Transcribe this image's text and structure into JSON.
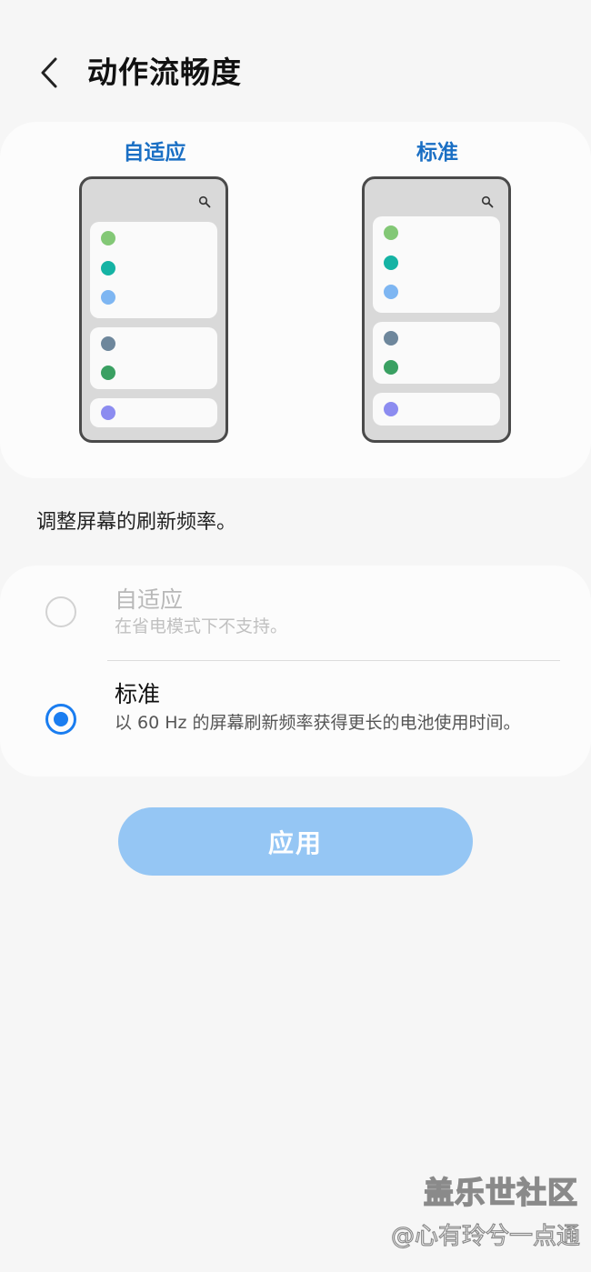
{
  "header": {
    "back_icon": "chevron-left-icon",
    "title": "动作流畅度"
  },
  "preview": {
    "adaptive_label": "自适应",
    "standard_label": "标准",
    "search_icon": "search-icon",
    "dot_colors": [
      "#83c876",
      "#15b3a4",
      "#7eb6f2",
      "#6e879c",
      "#3aa062",
      "#8c8cf0"
    ]
  },
  "description": "调整屏幕的刷新频率。",
  "options": {
    "adaptive": {
      "title": "自适应",
      "subtitle": "在省电模式下不支持。",
      "selected": false,
      "enabled": false
    },
    "standard": {
      "title": "标准",
      "subtitle": "以 60 Hz 的屏幕刷新频率获得更长的电池使用时间。",
      "selected": true,
      "enabled": true
    }
  },
  "apply_button": "应用",
  "watermark": {
    "site": "盖乐世社区",
    "user": "@心有玲兮一点通"
  },
  "colors": {
    "accent": "#1a7df0",
    "label_blue": "#1a6fc4",
    "apply_button_bg": "#95c6f4",
    "background": "#f6f6f6",
    "card": "#fcfcfc"
  }
}
